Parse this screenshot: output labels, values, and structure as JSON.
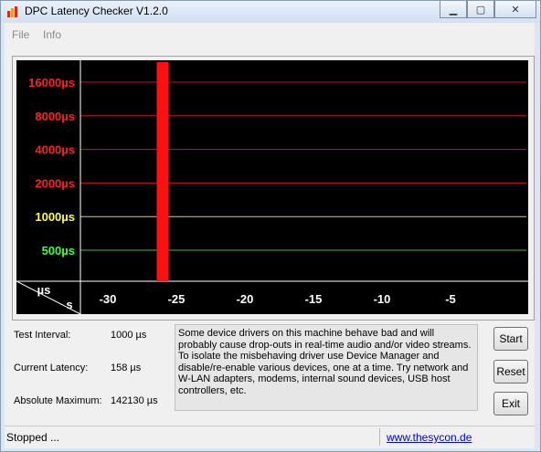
{
  "window": {
    "title": "DPC Latency Checker V1.2.0",
    "minimize_glyph": "▁",
    "maximize_glyph": "▢",
    "close_glyph": "✕"
  },
  "menu": {
    "items": [
      "File",
      "Info"
    ]
  },
  "chart_data": {
    "type": "bar",
    "y_axis_unit": "µs",
    "x_axis_unit": "s",
    "y_tick_labels": [
      {
        "label": "16000µs",
        "color": "#ff2020"
      },
      {
        "label": "8000µs",
        "color": "#ff2020"
      },
      {
        "label": "4000µs",
        "color": "#ff2020"
      },
      {
        "label": "2000µs",
        "color": "#ff2020"
      },
      {
        "label": "1000µs",
        "color": "#ffff40"
      },
      {
        "label": "500µs",
        "color": "#40ff40"
      }
    ],
    "y_tick_values": [
      16000,
      8000,
      4000,
      2000,
      1000,
      500
    ],
    "x_tick_labels": [
      "-30",
      "-25",
      "-20",
      "-15",
      "-10",
      "-5"
    ],
    "x_tick_values": [
      -30,
      -25,
      -20,
      -15,
      -10,
      -5
    ],
    "xlim": [
      -32.5,
      0
    ],
    "log_scale_y": true,
    "bars": [
      {
        "t": -32,
        "v": 180
      },
      {
        "t": -31,
        "v": 200
      },
      {
        "t": -30,
        "v": 180
      },
      {
        "t": -29,
        "v": 150
      },
      {
        "t": -28,
        "v": 180
      },
      {
        "t": -27,
        "v": 260
      },
      {
        "t": -26,
        "v": 142130
      },
      {
        "t": -25,
        "v": 170
      },
      {
        "t": -24,
        "v": 170
      },
      {
        "t": -23,
        "v": 170
      },
      {
        "t": -22,
        "v": 160
      },
      {
        "t": -21,
        "v": 170
      },
      {
        "t": -20,
        "v": 160
      },
      {
        "t": -19,
        "v": 170
      },
      {
        "t": -18,
        "v": 160
      },
      {
        "t": -17,
        "v": 165
      },
      {
        "t": -16,
        "v": 165
      },
      {
        "t": -15,
        "v": 165
      },
      {
        "t": -14,
        "v": 170
      },
      {
        "t": -13,
        "v": 165
      },
      {
        "t": -12,
        "v": 165
      },
      {
        "t": -11,
        "v": 170
      },
      {
        "t": -10,
        "v": 175
      },
      {
        "t": -9,
        "v": 165
      },
      {
        "t": -8,
        "v": 170
      },
      {
        "t": -7,
        "v": 165
      },
      {
        "t": -6,
        "v": 165
      },
      {
        "t": -5,
        "v": 165
      },
      {
        "t": -4,
        "v": 175
      },
      {
        "t": -3,
        "v": 165
      },
      {
        "t": -2,
        "v": 165
      },
      {
        "t": -1,
        "v": 160
      },
      {
        "t": 0,
        "v": 158
      }
    ],
    "colors": {
      "background": "#000000",
      "normal_bar": "#22e022",
      "critical_bar": "#ff1010",
      "red_line": "#c81818",
      "yellow_line": "#d8d848",
      "green_line": "#3cbf3c",
      "grid_vertical": "#ffffff"
    }
  },
  "stats": {
    "test_interval_label": "Test Interval:",
    "test_interval_value": "1000 µs",
    "current_latency_label": "Current Latency:",
    "current_latency_value": "158 µs",
    "absolute_max_label": "Absolute Maximum:",
    "absolute_max_value": "142130 µs"
  },
  "info": {
    "text": "Some device drivers on this machine behave bad and will probably cause drop-outs in real-time audio and/or video streams. To isolate the misbehaving driver use Device Manager and disable/re-enable various devices, one at a time. Try network and W-LAN adapters, modems, internal sound devices, USB host controllers, etc."
  },
  "buttons": {
    "start": "Start",
    "reset": "Reset",
    "exit": "Exit"
  },
  "status": {
    "text": "Stopped ...",
    "link": "www.thesycon.de"
  }
}
